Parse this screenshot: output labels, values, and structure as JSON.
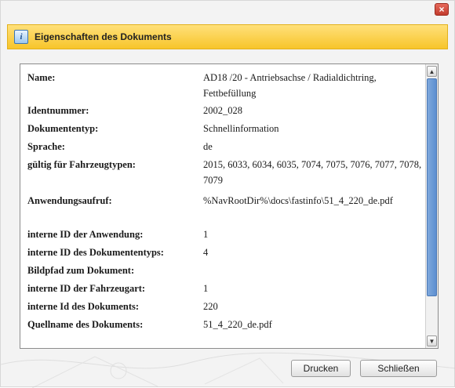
{
  "dialog": {
    "title": "Eigenschaften des Dokuments",
    "close_glyph": "×",
    "icon": "document-info-icon"
  },
  "properties": [
    {
      "label": "Name:",
      "value": "AD18 /20 - Antriebsachse / Radialdichtring, Fettbefüllung"
    },
    {
      "label": "Identnummer:",
      "value": "2002_028"
    },
    {
      "label": "Dokumententyp:",
      "value": "Schnellinformation"
    },
    {
      "label": "Sprache:",
      "value": "de"
    },
    {
      "label": "gültig für Fahrzeugtypen:",
      "value": "2015, 6033, 6034, 6035, 7074, 7075, 7076, 7077, 7078, 7079"
    },
    {
      "label": "Anwendungsaufruf:",
      "value": "%NavRootDir%\\docs\\fastinfo\\51_4_220_de.pdf"
    },
    {
      "label": "interne ID der Anwendung:",
      "value": "1"
    },
    {
      "label": "interne ID des Dokumententyps:",
      "value": "4"
    },
    {
      "label": "Bildpfad zum Dokument:",
      "value": ""
    },
    {
      "label": "interne ID der Fahrzeugart:",
      "value": "1"
    },
    {
      "label": "interne Id des Dokuments:",
      "value": "220"
    },
    {
      "label": "Quellname des Dokuments:",
      "value": "51_4_220_de.pdf"
    }
  ],
  "buttons": {
    "print": "Drucken",
    "close": "Schließen"
  },
  "colors": {
    "title_bar": "#f7c52a",
    "scroll_thumb": "#5d8fd0"
  }
}
